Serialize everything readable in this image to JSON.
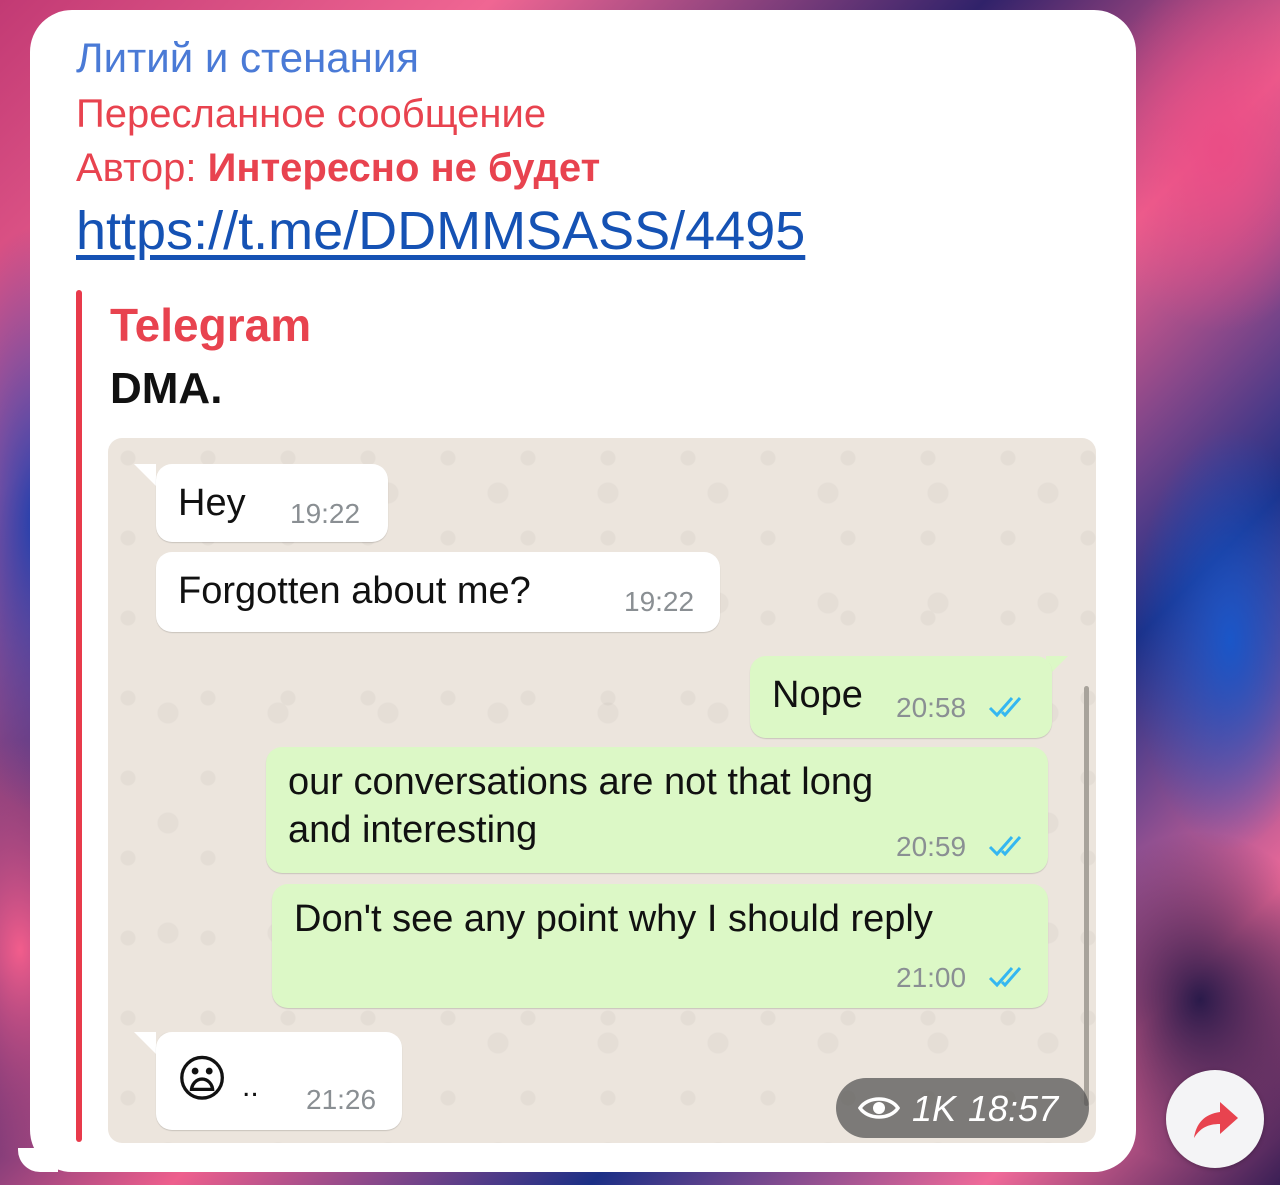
{
  "post": {
    "channel_name": "Литий и стенания",
    "forwarded_label": "Пересланное сообщение",
    "author_prefix": "Автор:",
    "author_name": "Интересно не будет",
    "link_text": "https://t.me/DDMMSASS/4495"
  },
  "preview": {
    "site_name": "Telegram",
    "title": "DMA."
  },
  "chat": {
    "messages": [
      {
        "direction": "incoming",
        "text": "Hey",
        "time": "19:22"
      },
      {
        "direction": "incoming",
        "text": "Forgotten about me?",
        "time": "19:22"
      },
      {
        "direction": "outgoing",
        "text": "Nope",
        "time": "20:58",
        "status": "read"
      },
      {
        "direction": "outgoing",
        "text_line1": "our conversations are not that long",
        "text_line2": "and interesting",
        "time": "20:59",
        "status": "read"
      },
      {
        "direction": "outgoing",
        "text": "Don't see any point why I should reply",
        "time": "21:00",
        "status": "read"
      },
      {
        "direction": "incoming",
        "emoji": "😦",
        "text_suffix": "..",
        "time": "21:26"
      }
    ]
  },
  "footer": {
    "views": "1K",
    "post_time": "18:57",
    "views_icon": "eye-icon",
    "share_icon": "share-arrow-icon"
  },
  "colors": {
    "channel_name": "#4a7ad6",
    "forward_red": "#e8434f",
    "link": "#1552b4",
    "outgoing_bubble": "#dcf8c6",
    "read_ticks": "#34b7f1",
    "share_arrow": "#e8434f"
  }
}
